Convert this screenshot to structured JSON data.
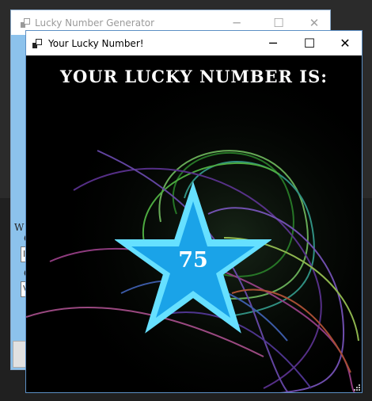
{
  "back_window": {
    "title": "Lucky Number Generator",
    "label_w": "W",
    "label_c1": "C",
    "label_c2": "C",
    "input1_value": "I",
    "input2_value": "V"
  },
  "front_window": {
    "title": "Your Lucky Number!",
    "controls": {
      "minimize": "─",
      "maximize": "☐",
      "close": "✕"
    }
  },
  "content": {
    "headline": "YOUR LUCKY NUMBER IS:",
    "lucky_number": "75"
  },
  "colors": {
    "star_fill": "#1aa3e8",
    "star_outline": "#66e0ff",
    "window_border": "#5c8fc4"
  }
}
